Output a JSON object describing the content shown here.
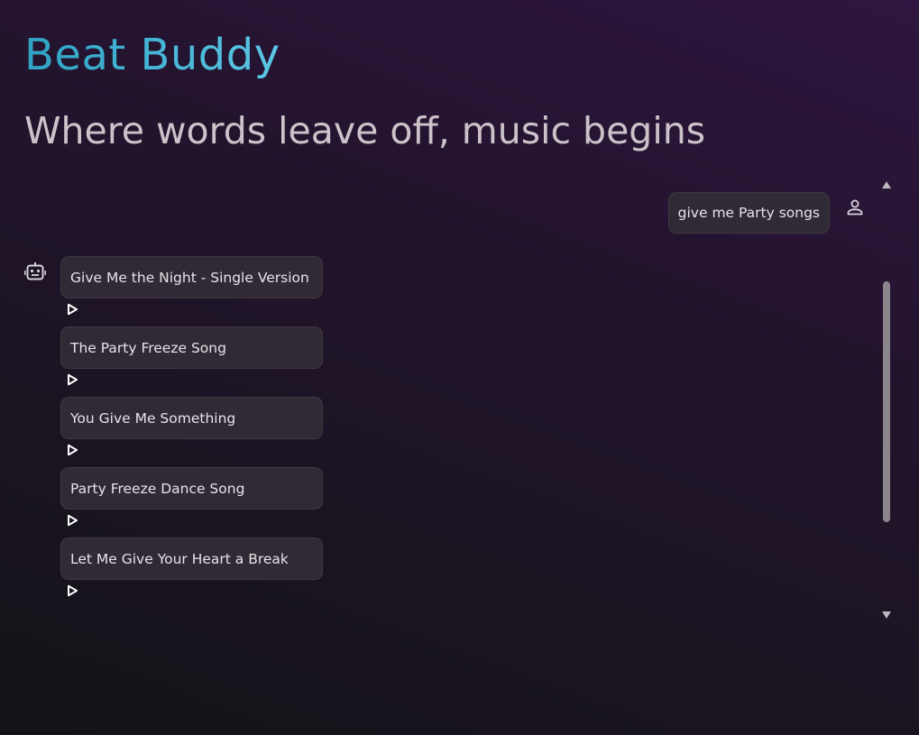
{
  "header": {
    "app_title": "Beat Buddy",
    "tagline": "Where words leave off, music begins"
  },
  "chat": {
    "user_message": "give me Party songs",
    "bot_songs": [
      "Give Me the Night - Single Version",
      "The Party Freeze Song",
      "You Give Me Something",
      "Party Freeze Dance Song",
      "Let Me Give Your Heart a Break"
    ]
  },
  "icons": {
    "user": "person-icon",
    "bot": "robot-icon",
    "play": "play-icon",
    "scroll_up": "triangle-up-icon",
    "scroll_down": "triangle-down-icon"
  },
  "colors": {
    "title_gradient_start": "#2fa3c4",
    "title_gradient_end": "#5cc7e6",
    "tagline": "#cbc3c9",
    "bubble_bg": "#2f2a33",
    "bubble_border": "#3e3842"
  }
}
